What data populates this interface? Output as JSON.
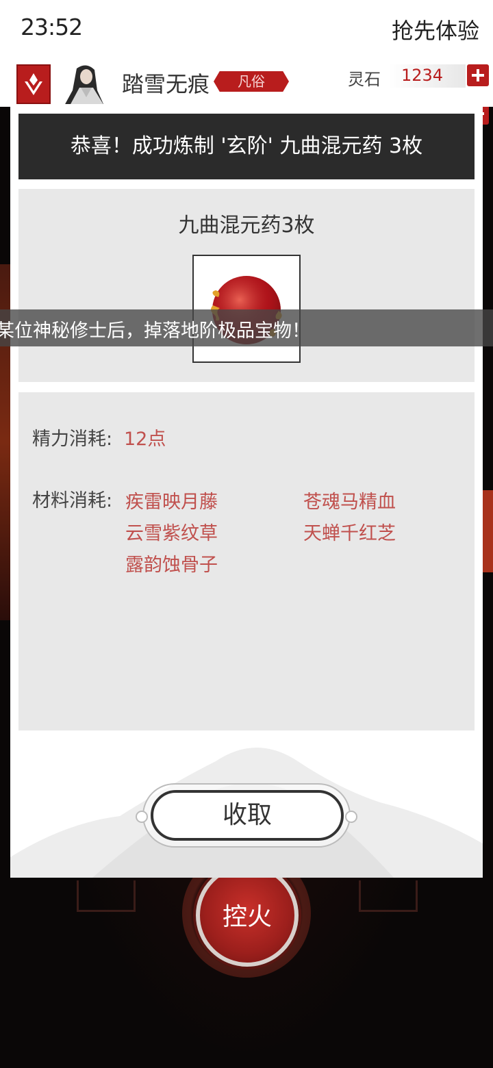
{
  "status_bar": {
    "time": "23:52",
    "action": "抢先体验"
  },
  "header": {
    "player_name": "踏雪无痕",
    "rank": "凡俗",
    "currency_label": "灵石",
    "currency_value": "1234"
  },
  "dialog": {
    "title": "恭喜！成功炼制 '玄阶' 九曲混元药 3枚",
    "item_name": "九曲混元药3枚",
    "energy_label": "精力消耗:",
    "energy_value": "12点",
    "materials_label": "材料消耗:",
    "materials": [
      "疾雷映月藤",
      "苍魂马精血",
      "云雪紫纹草",
      "天蝉千红芝",
      "露韵蚀骨子"
    ],
    "collect_label": "收取"
  },
  "marquee": "某位神秘修士后，掉落地阶极品宝物！",
  "fire_button_label": "控火",
  "colors": {
    "accent_red": "#b81d1d",
    "material_text": "#c0504d",
    "header_bg": "#2b2b2b"
  },
  "icons": [
    "sect-emblem-icon",
    "avatar",
    "add-icon",
    "elixir-pill-icon"
  ]
}
